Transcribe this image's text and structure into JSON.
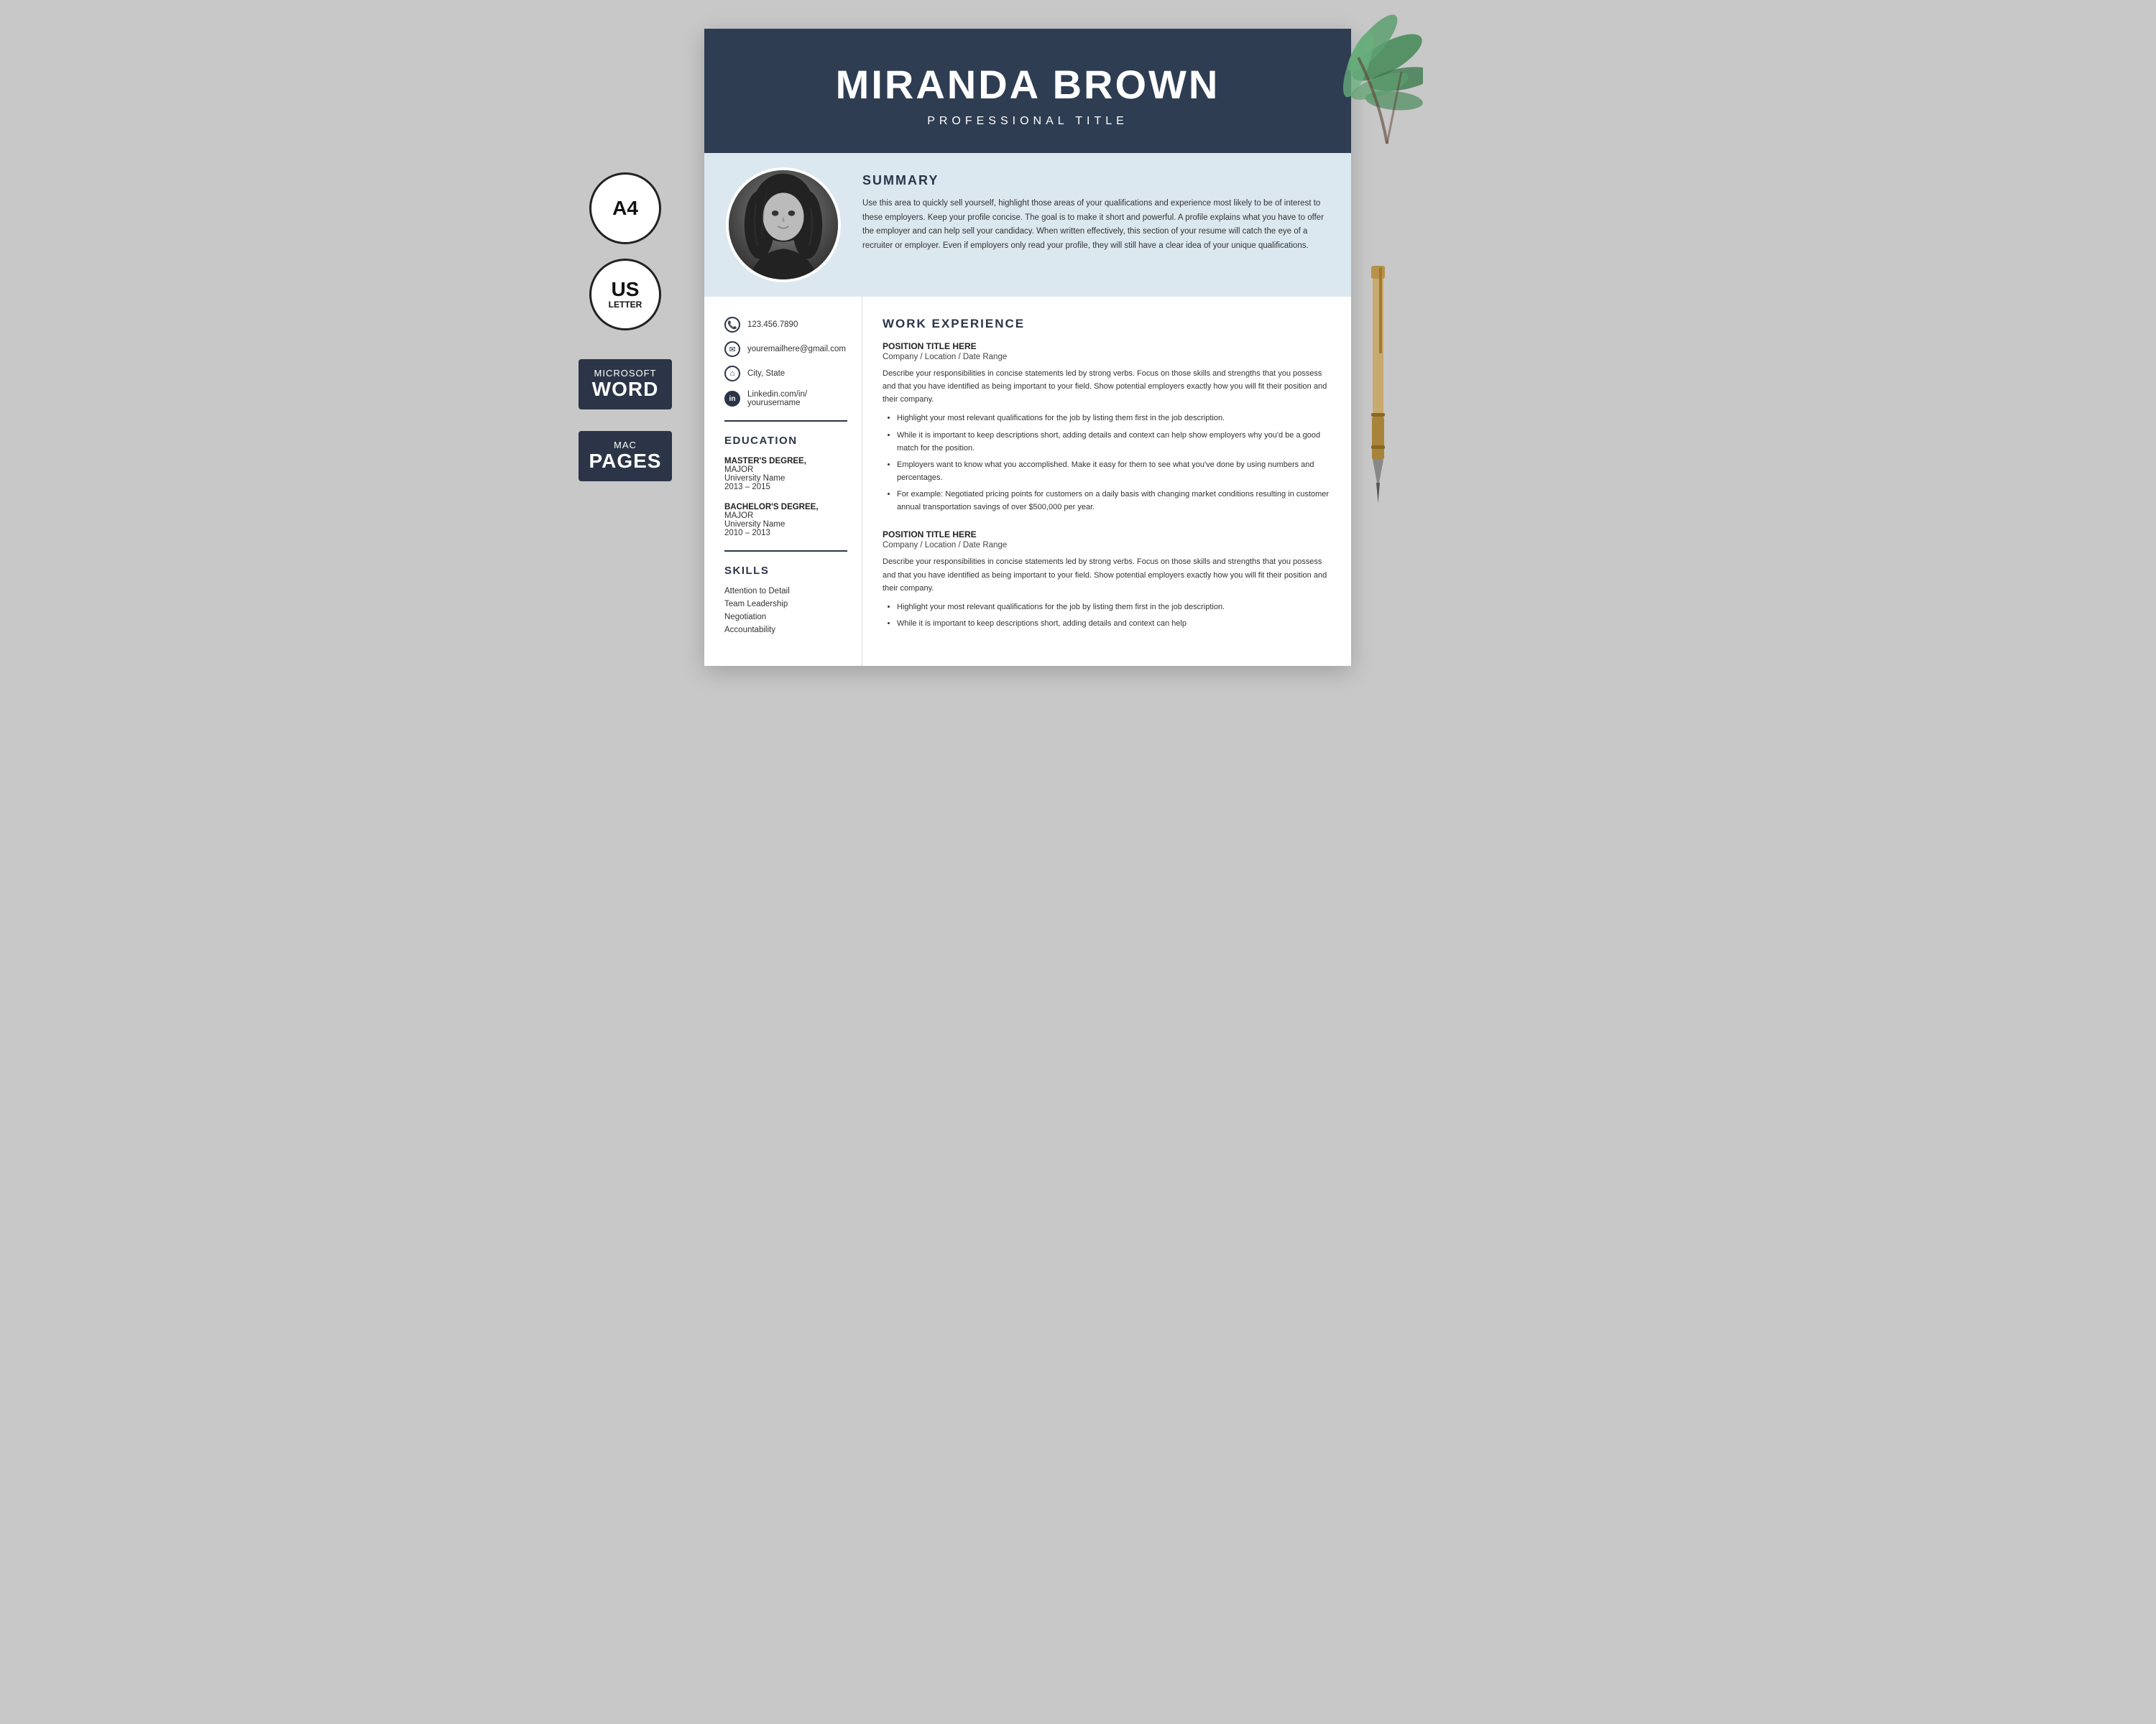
{
  "header": {
    "name": "MIRANDA BROWN",
    "title": "PROFESSIONAL TITLE"
  },
  "summary": {
    "section_label": "SUMMARY",
    "text": "Use this area to quickly sell yourself, highlight those areas of your qualifications and experience most likely to be of interest to these employers. Keep your profile concise. The goal is to make it short and powerful. A profile explains what you have to offer the employer and can help sell your candidacy. When written effectively, this section of your resume will catch the eye of a recruiter or employer. Even if employers only read your profile, they will still have a clear idea of your unique qualifications."
  },
  "contact": {
    "phone": "123.456.7890",
    "email": "youremailhere@gmail.com",
    "location": "City, State",
    "linkedin": "Linkedin.com/in/ yourusername"
  },
  "education": {
    "section_label": "EDUCATION",
    "entries": [
      {
        "degree": "MASTER'S DEGREE,",
        "major": "MAJOR",
        "school": "University Name",
        "years": "2013 – 2015"
      },
      {
        "degree": "BACHELOR'S DEGREE,",
        "major": "MAJOR",
        "school": "University Name",
        "years": "2010 – 2013"
      }
    ]
  },
  "skills": {
    "section_label": "SKILLS",
    "items": [
      "Attention to Detail",
      "Team Leadership",
      "Negotiation",
      "Accountability"
    ]
  },
  "work_experience": {
    "section_label": "WORK EXPERIENCE",
    "jobs": [
      {
        "title": "POSITION TITLE HERE",
        "sub": "Company / Location / Date Range",
        "description": "Describe your responsibilities in concise statements led by strong verbs. Focus on those skills and strengths that you possess and that you have identified as being important to your field. Show potential employers exactly how you will fit their position and their company.",
        "bullets": [
          "Highlight your most relevant qualifications for the job by listing them first in the job description.",
          "While it is important to keep descriptions short, adding details and context can help show employers why you'd be a good match for the position.",
          "Employers want to know what you accomplished. Make it easy for them to see what you've done by using numbers and percentages.",
          "For example: Negotiated pricing points for customers on a daily basis with changing market conditions resulting in customer annual transportation savings of over $500,000 per year."
        ]
      },
      {
        "title": "POSITION TITLE HERE",
        "sub": "Company / Location / Date Range",
        "description": "Describe your responsibilities in concise statements led by strong verbs. Focus on those skills and strengths that you possess and that you have identified as being important to your field. Show potential employers exactly how you will fit their position and their company.",
        "bullets": [
          "Highlight your most relevant qualifications for the job by listing them first in the job description.",
          "While it is important to keep descriptions short, adding details and context can help"
        ]
      }
    ]
  },
  "badges": {
    "a4": {
      "main": "A4",
      "sub": ""
    },
    "us_letter": {
      "main": "US",
      "sub": "LETTER"
    },
    "word": {
      "top": "MICROSOFT",
      "bot": "WORD"
    },
    "pages": {
      "top": "MAC",
      "bot": "PAGES"
    }
  }
}
